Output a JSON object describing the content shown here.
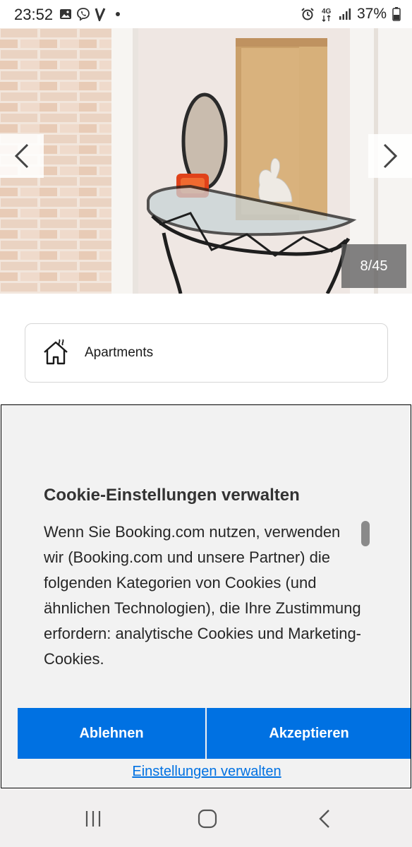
{
  "status_bar": {
    "time": "23:52",
    "battery_percent": "37%",
    "network": "4G",
    "icons_left": [
      "gallery-icon",
      "viber-icon",
      "v-app-icon",
      "dot-icon"
    ],
    "icons_right": [
      "alarm-icon",
      "4g-icon",
      "signal-icon",
      "battery-icon"
    ]
  },
  "gallery": {
    "counter": "8/45",
    "current_index": 8,
    "total": 45,
    "prev_icon": "chevron-left-icon",
    "next_icon": "chevron-right-icon"
  },
  "property_type": {
    "icon": "house-icon",
    "label": "Apartments"
  },
  "cookie_dialog": {
    "title": "Cookie-Einstellungen verwalten",
    "body": "Wenn Sie Booking.com nutzen, verwenden wir (Booking.com und unsere Partner) die folgenden Kategorien von Cookies (und ähnlichen Technologien), die Ihre Zustimmung erfordern: analytische Cookies und Marketing-Cookies.",
    "reject_label": "Ablehnen",
    "accept_label": "Akzeptieren",
    "manage_label": "Einstellungen verwalten",
    "accent_color": "#0071e2"
  },
  "nav_bar": {
    "icons": [
      "recent-apps-icon",
      "home-icon",
      "back-icon"
    ]
  }
}
